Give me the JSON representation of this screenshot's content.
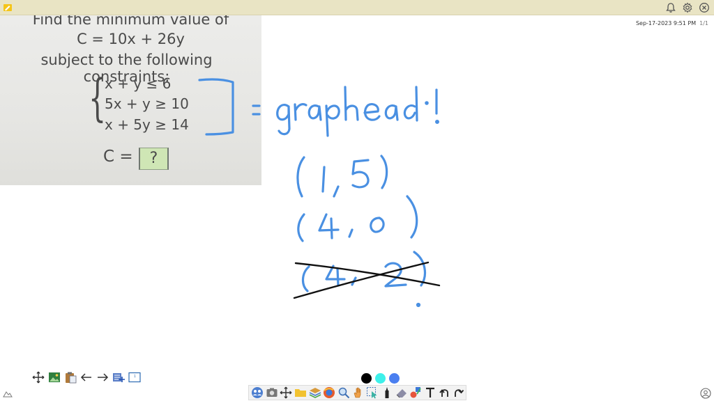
{
  "header": {
    "timestamp": "Sep-17-2023 9:51 PM",
    "page_indicator": "1/1"
  },
  "problem": {
    "line1": "Find the minimum value of",
    "line2": "C = 10x + 26y",
    "line3": "subject to the following constraints:",
    "constraints": [
      "x + y ≤ 6",
      "5x + y ≥ 10",
      "x + 5y ≥ 14"
    ],
    "answer_prefix": "C =",
    "answer_placeholder": "?"
  },
  "handwriting": {
    "note": "= graphed!",
    "points": [
      "(1,5)",
      "(4,0)",
      "(4,2)"
    ],
    "crossed_out": "(4,2)"
  },
  "colors": {
    "ink_blue": "#4a90e2",
    "ink_black": "#111111",
    "swatches": [
      "#000000",
      "#3ef0ea",
      "#4a7ff0"
    ],
    "topbar": "#e9e4c4"
  },
  "icons": {
    "topbar": [
      "bell-icon",
      "gear-icon",
      "close-icon"
    ],
    "left_toolbar": [
      "move-icon",
      "image-icon",
      "paste-icon",
      "undo-arrow-icon",
      "redo-arrow-icon",
      "add-page-icon",
      "page-icon"
    ],
    "bottom_toolbar": [
      "people-icon",
      "camera-icon",
      "move-icon",
      "folder-icon",
      "layers-icon",
      "browser-icon",
      "zoom-icon",
      "hand-icon",
      "select-icon",
      "marker-icon",
      "eraser-icon",
      "shapes-icon",
      "text-icon",
      "undo-icon",
      "redo-icon"
    ]
  }
}
